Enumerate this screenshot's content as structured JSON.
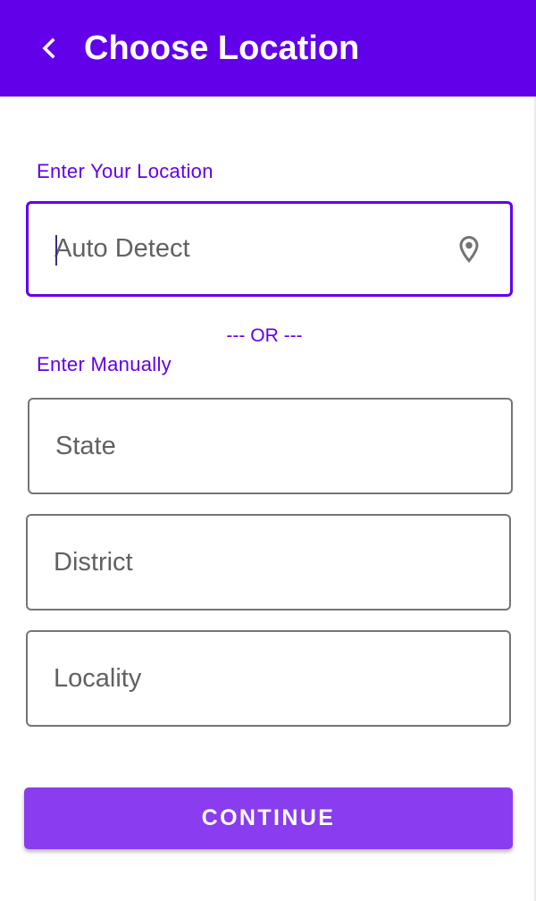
{
  "header": {
    "title": "Choose Location",
    "back_icon": "chevron-left-icon",
    "background_color": "#6200EA"
  },
  "auto_section": {
    "label": "Enter Your Location",
    "input": {
      "placeholder": "Auto Detect",
      "value": ""
    },
    "pin_icon": "location-pin-icon"
  },
  "divider_text": "--- OR ---",
  "manual_section": {
    "label": "Enter Manually",
    "state": {
      "placeholder": "State",
      "value": ""
    },
    "district": {
      "placeholder": "District",
      "value": ""
    },
    "locality": {
      "placeholder": "Locality",
      "value": ""
    }
  },
  "continue_button": {
    "label": "CONTINUE",
    "color": "#8A3CEF"
  },
  "colors": {
    "accent": "#6200EA",
    "field_border": "#757575",
    "placeholder": "#616161"
  }
}
